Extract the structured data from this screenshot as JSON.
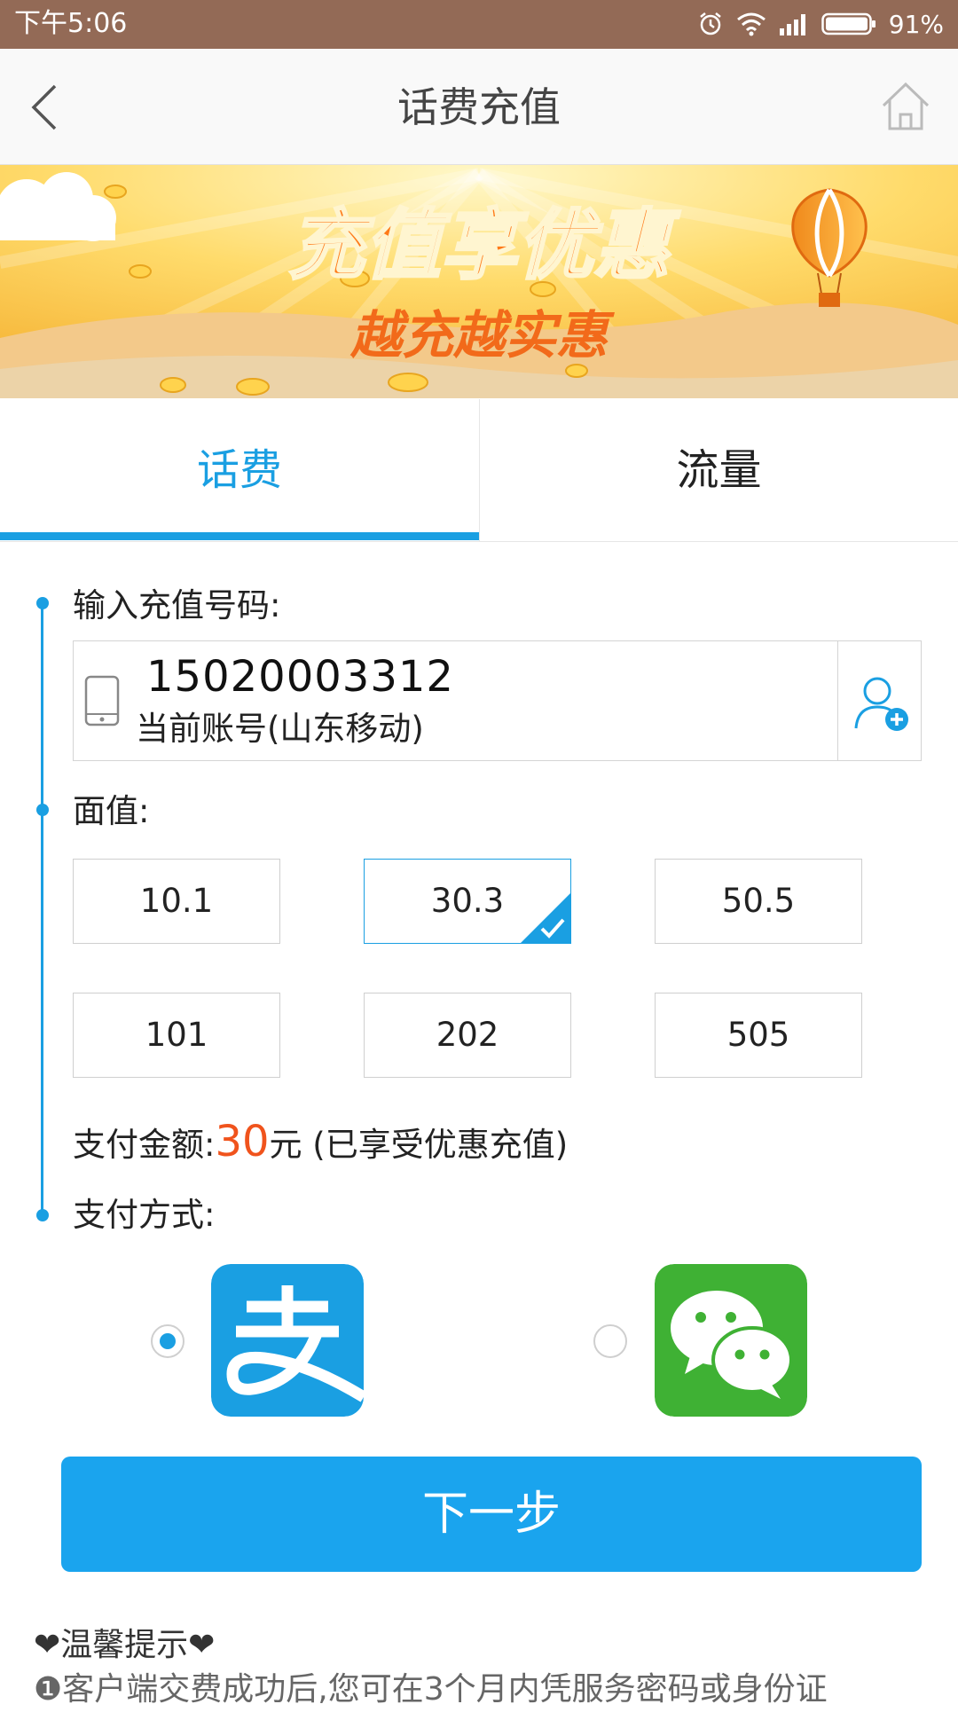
{
  "status_bar": {
    "time": "下午5:06",
    "battery": "91%",
    "icons": [
      "alarm-icon",
      "wifi-icon",
      "signal-icon",
      "battery-icon"
    ]
  },
  "header": {
    "title": "话费充值",
    "back_icon": "chevron-left-icon",
    "home_icon": "home-icon"
  },
  "banner": {
    "headline": "充值享优惠",
    "subline": "越充越实惠"
  },
  "tabs": [
    {
      "label": "话费",
      "active": true
    },
    {
      "label": "流量",
      "active": false
    }
  ],
  "form": {
    "phone_label": "输入充值号码:",
    "phone_number": "15020003312",
    "account_info": "当前账号(山东移动)",
    "amount_label": "面值:",
    "amounts": [
      {
        "value": "10.1",
        "selected": false
      },
      {
        "value": "30.3",
        "selected": true
      },
      {
        "value": "50.5",
        "selected": false
      },
      {
        "value": "101",
        "selected": false
      },
      {
        "value": "202",
        "selected": false
      },
      {
        "value": "505",
        "selected": false
      }
    ],
    "pay_amount_prefix": "支付金额:",
    "pay_amount_value": "30",
    "pay_amount_suffix": "元 (已享受优惠充值)",
    "pay_method_label": "支付方式:",
    "pay_methods": [
      {
        "name": "alipay",
        "selected": true
      },
      {
        "name": "wechat-pay",
        "selected": false
      }
    ]
  },
  "next_button": "下一步",
  "tips": {
    "title": "❤温馨提示❤",
    "line1_marker": "❶",
    "line1": "客户端交费成功后,您可在3个月内凭服务密码或身份证"
  },
  "colors": {
    "accent": "#1a9fe2",
    "status_bar": "#936a56",
    "price": "#f0531c",
    "alipay": "#1a9fe2",
    "wechat": "#3fb134",
    "button": "#1aa4ee"
  }
}
